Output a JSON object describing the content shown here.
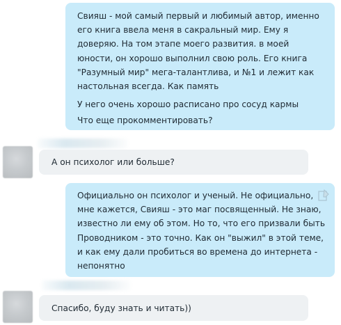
{
  "messages": [
    {
      "direction": "outgoing",
      "lines": [
        "Свияш - мой самый первый и любимый автор, именно",
        "его книга ввела меня в сакральный мир. Ему я",
        "доверяю. На том этапе моего развития. в моей",
        "юности, он хорошо выполнил свою роль. Его книга",
        "\"Разумный мир\" мега-талантлива, и №1 и лежит как",
        "настольная всегда. Как память"
      ],
      "extra_lines": [
        "У него очень хорошо расписано про сосуд кармы",
        "Что еще прокомментировать?"
      ]
    },
    {
      "direction": "incoming",
      "text": "А он психолог или больше?"
    },
    {
      "direction": "outgoing",
      "lines": [
        "Официально он психолог и ученый. Не официально,",
        "мне кажется, Свияш - это маг посвященный. Не знаю,",
        "известно ли ему об этом. Но то, что его призвали быть",
        "Проводником - это точно. Как он \"выжил\" в этой теме,",
        "и как ему дали пробиться во времена до интернета -",
        "непонятно"
      ]
    },
    {
      "direction": "incoming",
      "text": "Спасибо, буду знать и читать))"
    }
  ],
  "colors": {
    "outgoing_bubble": "#c9ebfa",
    "incoming_bubble": "#eef1f3",
    "text": "#1f2a33"
  },
  "icons": {
    "avatar": "blurred-avatar",
    "message_status": "message-edit-icon"
  }
}
